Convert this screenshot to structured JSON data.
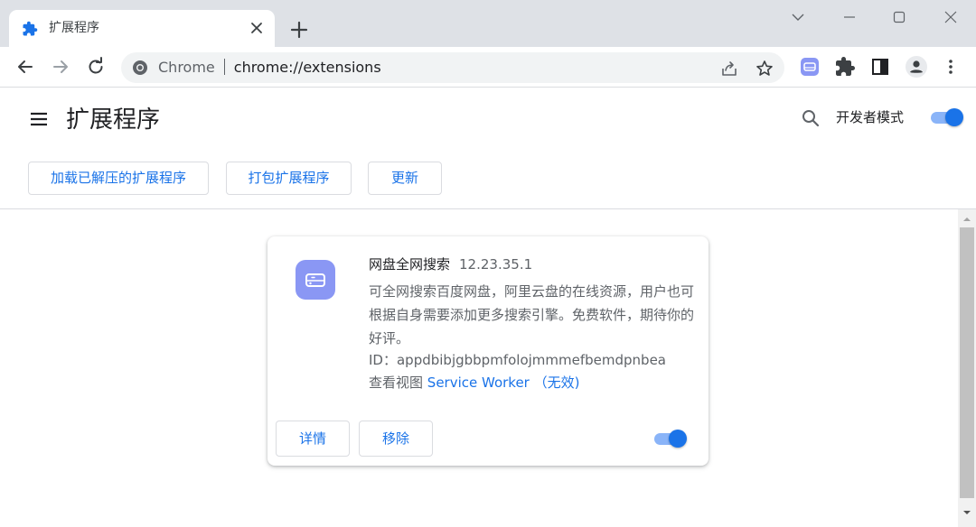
{
  "tab": {
    "title": "扩展程序",
    "icon": "puzzle-icon",
    "close_icon": "close-icon"
  },
  "window_controls": [
    "chevron-down-icon",
    "minimize-icon",
    "maximize-icon",
    "close-icon"
  ],
  "toolbar": {
    "back_icon": "back-arrow-icon",
    "forward_icon": "forward-arrow-icon",
    "reload_icon": "reload-icon",
    "omnibox": {
      "site_label": "Chrome",
      "url": "chrome://extensions"
    },
    "right_icons": [
      "share-icon",
      "star-icon",
      "extension-drive-icon",
      "puzzle-icon",
      "side-panel-icon",
      "profile-icon",
      "more-vert-icon"
    ]
  },
  "header": {
    "title": "扩展程序",
    "dev_mode_label": "开发者模式",
    "dev_mode_on": true,
    "buttons": [
      "加载已解压的扩展程序",
      "打包扩展程序",
      "更新"
    ]
  },
  "extension": {
    "name": "网盘全网搜索",
    "version": "12.23.35.1",
    "description": "可全网搜索百度网盘，阿里云盘的在线资源，用户也可根据自身需要添加更多搜索引擎。免费软件，期待你的好评。",
    "id_label": "ID：",
    "id_value": "appdbibjgbbpmfolojmmmefbemdpnbea",
    "views_label": "查看视图",
    "views_link": "Service Worker （无效)",
    "details_button": "详情",
    "remove_button": "移除",
    "enabled": true
  },
  "colors": {
    "accent": "#1a73e8",
    "toggle_track": "#8ab4f8",
    "tabstrip": "#dee1e6",
    "extension_icon": "#8a97f4"
  }
}
